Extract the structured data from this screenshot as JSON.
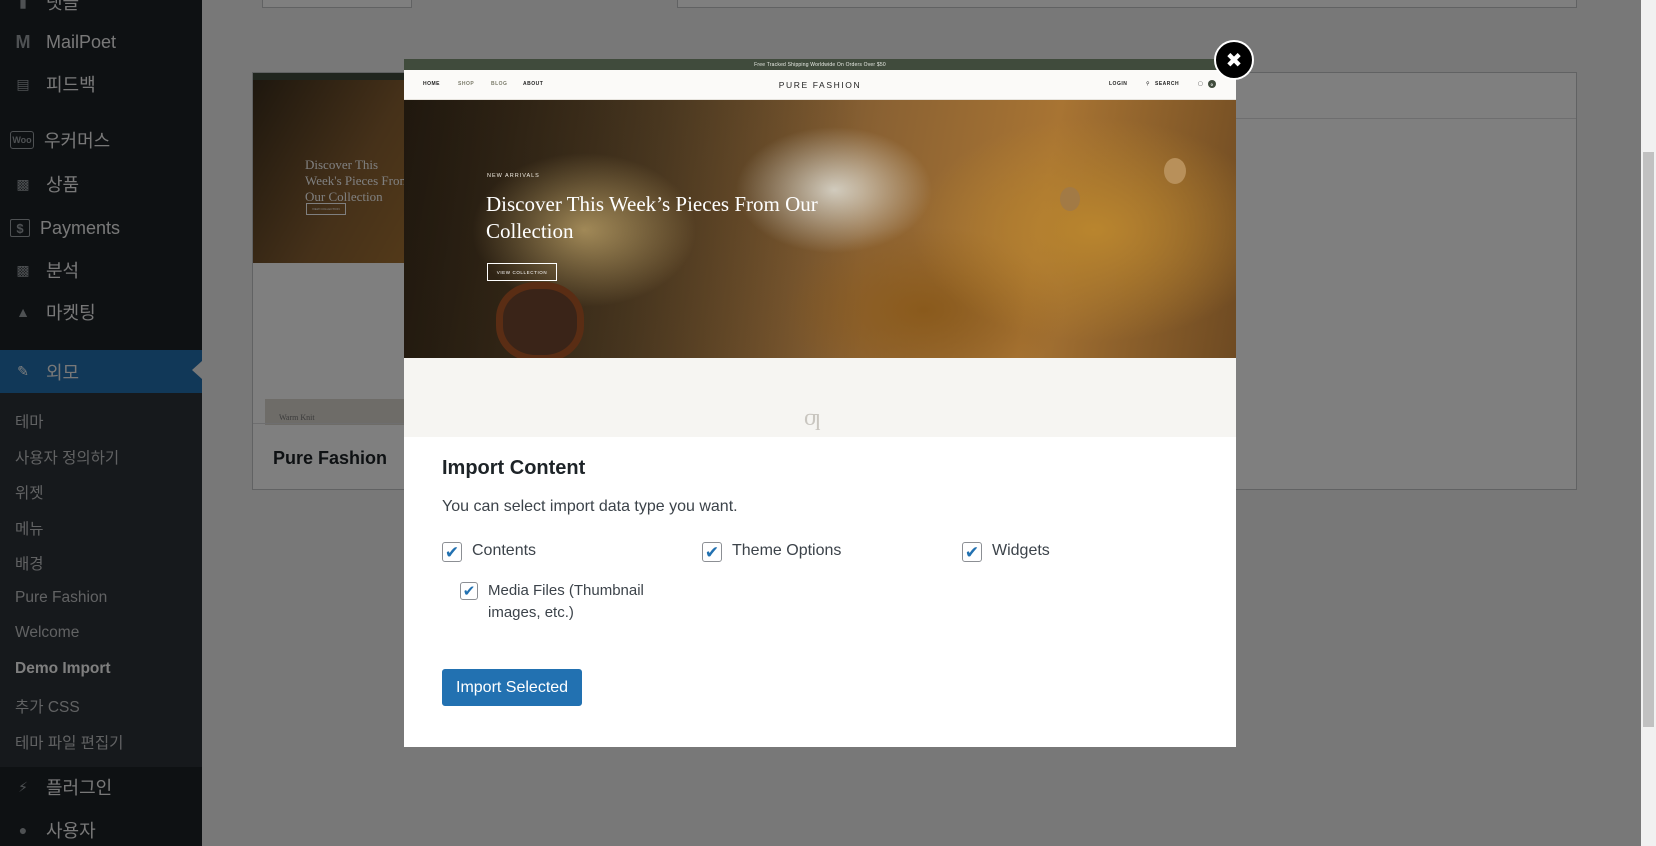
{
  "sidebar": {
    "items": [
      {
        "label": "댓글",
        "icon": "comment-icon"
      },
      {
        "label": "MailPoet",
        "icon": "mailpoet-icon"
      },
      {
        "label": "피드백",
        "icon": "feedback-icon"
      },
      {
        "label": "우커머스",
        "icon": "woo-icon"
      },
      {
        "label": "상품",
        "icon": "archive-icon"
      },
      {
        "label": "Payments",
        "icon": "dollar-icon"
      },
      {
        "label": "분석",
        "icon": "chart-bar-icon"
      },
      {
        "label": "마켓팅",
        "icon": "megaphone-icon"
      },
      {
        "label": "외모",
        "icon": "paintbrush-icon"
      },
      {
        "label": "플러그인",
        "icon": "plugin-icon"
      },
      {
        "label": "사용자",
        "icon": "user-icon"
      }
    ],
    "submenu": [
      {
        "label": "테마"
      },
      {
        "label": "사용자 정의하기"
      },
      {
        "label": "위젯"
      },
      {
        "label": "메뉴"
      },
      {
        "label": "배경"
      },
      {
        "label": "Pure Fashion"
      },
      {
        "label": "Welcome"
      },
      {
        "label": "Demo Import"
      },
      {
        "label": "추가 CSS"
      },
      {
        "label": "테마 파일 편집기"
      }
    ]
  },
  "background": {
    "theme_name": "Pure Fashion",
    "right_card_text": "d",
    "mini_heading": "Discover This Week's Pieces From Our Collection",
    "mini_cta": "VIEW COLLECTION",
    "mini_caption": "Warm Knit"
  },
  "modal": {
    "preview": {
      "topbar": "Free Tracked Shipping Worldwide On Orders Over $50",
      "nav_left": [
        "HOME",
        "SHOP",
        "BLOG",
        "ABOUT"
      ],
      "brand": "PURE FASHION",
      "login": "LOGIN",
      "search": "SEARCH",
      "cart_count": "0",
      "eyebrow": "NEW ARRIVALS",
      "heading": "Discover This Week’s Pieces From Our Collection",
      "cta": "VIEW COLLECTION"
    },
    "title": "Import Content",
    "description": "You can select import data type you want.",
    "options": {
      "contents": "Contents",
      "theme_options": "Theme Options",
      "widgets": "Widgets",
      "media_files": "Media Files (Thumbnail images, etc.)"
    },
    "button": "Import Selected"
  }
}
